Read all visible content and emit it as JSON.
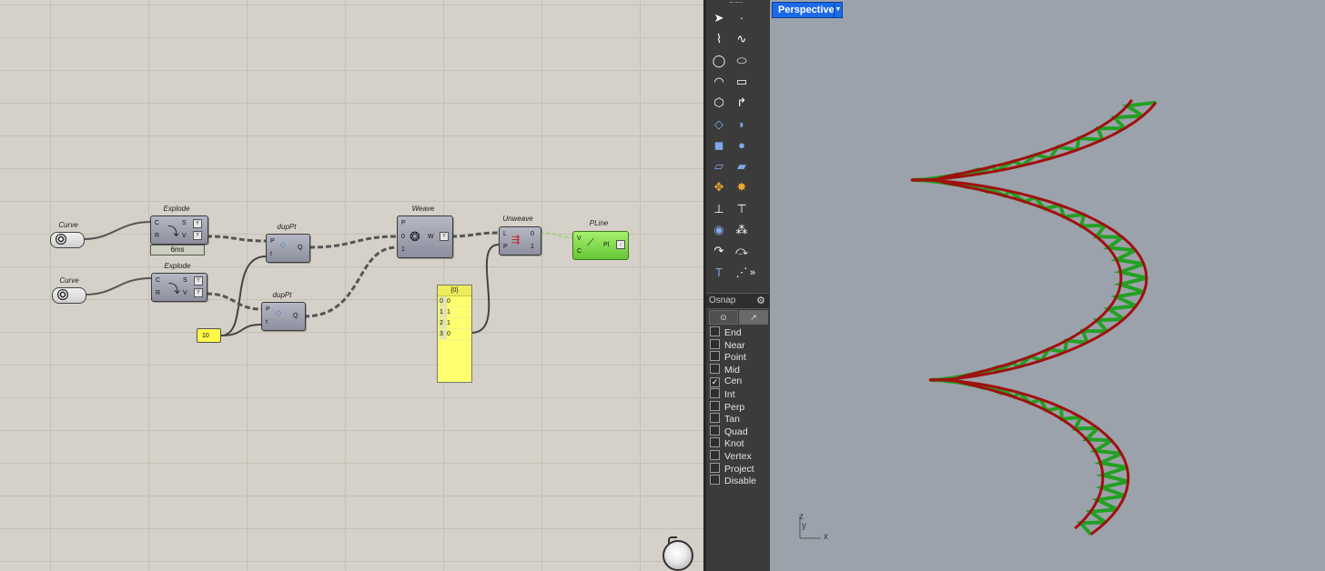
{
  "grasshopper": {
    "components": {
      "curve1": {
        "title": "Curve"
      },
      "curve2": {
        "title": "Curve"
      },
      "explode1": {
        "title": "Explode",
        "inputs": [
          "C",
          "R"
        ],
        "outputs": [
          "S",
          "V"
        ],
        "timer": "6ms"
      },
      "explode2": {
        "title": "Explode",
        "inputs": [
          "C",
          "R"
        ],
        "outputs": [
          "S",
          "V"
        ]
      },
      "dupPt1": {
        "title": "dupPt",
        "inputs": [
          "P",
          "t"
        ],
        "outputs": [
          "Q"
        ]
      },
      "dupPt2": {
        "title": "dupPt",
        "inputs": [
          "P",
          "t"
        ],
        "outputs": [
          "Q"
        ]
      },
      "slider": {
        "value": "10"
      },
      "weave": {
        "title": "Weave",
        "inputs": [
          "P",
          "0",
          "1"
        ],
        "outputs": [
          "W"
        ]
      },
      "panel": {
        "header": "{0}",
        "rows": [
          {
            "index": "0",
            "value": "0"
          },
          {
            "index": "1",
            "value": "1"
          },
          {
            "index": "2",
            "value": "1"
          },
          {
            "index": "3",
            "value": "0"
          }
        ]
      },
      "unweave": {
        "title": "Unweave",
        "inputs": [
          "L",
          "P"
        ],
        "outputs": [
          "0",
          "1"
        ]
      },
      "pline": {
        "title": "PLine",
        "inputs": [
          "V",
          "C"
        ],
        "outputs": [
          "Pl"
        ]
      }
    }
  },
  "toolbar": {
    "icons": [
      "select-arrow-icon",
      "point-icon",
      "polyline-icon",
      "curve-icon",
      "circle-icon",
      "ellipse-icon",
      "arc-icon",
      "rectangle-icon",
      "polygon-icon",
      "fillet-curve-icon",
      "surface-points-icon",
      "sweep-surface-icon",
      "box-solid-icon",
      "sphere-solid-icon",
      "mesh-plane-icon",
      "mesh-box-icon",
      "transform-icon",
      "explode-icon",
      "dimension-icon",
      "text-dot-icon",
      "boolean-union-icon",
      "group-icon",
      "curve-from-object-icon",
      "arc-blend-icon",
      "text-icon",
      "array-icon",
      "more-icon"
    ]
  },
  "osnap": {
    "title": "Osnap",
    "items": [
      {
        "label": "End",
        "checked": false
      },
      {
        "label": "Near",
        "checked": false
      },
      {
        "label": "Point",
        "checked": false
      },
      {
        "label": "Mid",
        "checked": false
      },
      {
        "label": "Cen",
        "checked": true
      },
      {
        "label": "Int",
        "checked": false
      },
      {
        "label": "Perp",
        "checked": false
      },
      {
        "label": "Tan",
        "checked": false
      },
      {
        "label": "Quad",
        "checked": false
      },
      {
        "label": "Knot",
        "checked": false
      },
      {
        "label": "Vertex",
        "checked": false
      },
      {
        "label": "Project",
        "checked": false
      },
      {
        "label": "Disable",
        "checked": false
      }
    ]
  },
  "viewport": {
    "name": "Perspective",
    "axis_x": "x",
    "axis_y": "y",
    "axis_z": "z",
    "colors": {
      "rail": "#a01010",
      "bracing": "#22a022",
      "background": "#9ca2ab",
      "tab": "#1c6ae8"
    }
  }
}
